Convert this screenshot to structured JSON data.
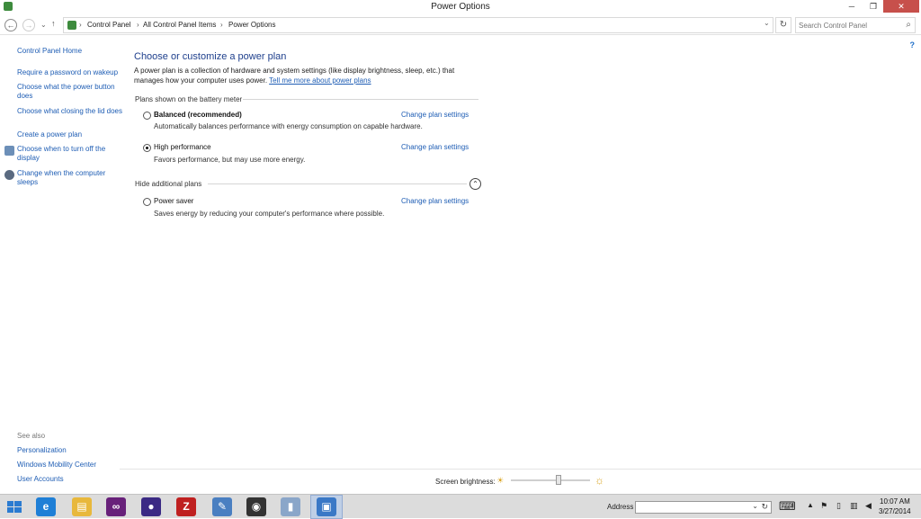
{
  "window": {
    "title": "Power Options",
    "min": "─",
    "max": "❐",
    "close": "✕"
  },
  "address_bar": {
    "back": "←",
    "forward": "→",
    "up": "↑",
    "crumbs": [
      "Control Panel",
      "All Control Panel Items",
      "Power Options"
    ],
    "separator": "›",
    "dropdown": "⌄",
    "refresh": "↻",
    "search_placeholder": "Search Control Panel",
    "search_icon": "⌕"
  },
  "help": "?",
  "sidebar": {
    "home": "Control Panel Home",
    "items": [
      {
        "label": "Require a password on wakeup"
      },
      {
        "label": "Choose what the power button does"
      },
      {
        "label": "Choose what closing the lid does"
      },
      {
        "label": "Create a power plan"
      },
      {
        "label": "Choose when to turn off the display",
        "icon": "display-icon"
      },
      {
        "label": "Change when the computer sleeps",
        "icon": "moon-icon"
      }
    ],
    "see_also": {
      "heading": "See also",
      "links": [
        "Personalization",
        "Windows Mobility Center",
        "User Accounts"
      ]
    }
  },
  "main": {
    "title": "Choose or customize a power plan",
    "description": "A power plan is a collection of hardware and system settings (like display brightness, sleep, etc.) that manages how your computer uses power.",
    "learn_more": "Tell me more about power plans",
    "battery_heading": "Plans shown on the battery meter",
    "hide_additional": "Hide additional plans",
    "collapse_glyph": "⌃",
    "change_label": "Change plan settings",
    "plans": [
      {
        "name": "Balanced (recommended)",
        "desc": "Automatically balances performance with energy consumption on capable hardware.",
        "selected": false
      },
      {
        "name": "High performance",
        "desc": "Favors performance, but may use more energy.",
        "selected": true
      },
      {
        "name": "Power saver",
        "desc": "Saves energy by reducing your computer's performance where possible.",
        "selected": false
      }
    ]
  },
  "brightness": {
    "label": "Screen brightness:",
    "level": 0.6,
    "dim_icon": "☀",
    "bright_icon": "☼"
  },
  "taskbar": {
    "start_icon": "windows-logo-icon",
    "apps": [
      {
        "name": "internet-explorer-icon",
        "glyph": "e",
        "color": "#1f7fd6"
      },
      {
        "name": "file-explorer-icon",
        "glyph": "▤",
        "color": "#e8b83c"
      },
      {
        "name": "visual-studio-icon",
        "glyph": "∞",
        "color": "#68217a"
      },
      {
        "name": "eclipse-icon",
        "glyph": "●",
        "color": "#3b2a84"
      },
      {
        "name": "filezilla-icon",
        "glyph": "Z",
        "color": "#bf2020"
      },
      {
        "name": "notepad-icon",
        "glyph": "✎",
        "color": "#4a7fc1"
      },
      {
        "name": "camera-app-icon",
        "glyph": "◉",
        "color": "#333333"
      },
      {
        "name": "document-app-icon",
        "glyph": "▮",
        "color": "#8aa6c9"
      },
      {
        "name": "control-panel-taskbar-icon",
        "glyph": "▣",
        "color": "#3a78c6"
      }
    ],
    "address_label": "Address",
    "address_dropdown": "⌄",
    "address_refresh": "↻",
    "tray_keyboard": "⌨",
    "tray_up": "▲",
    "tray_flag": "⚑",
    "tray_battery": "▯",
    "tray_network": "▥",
    "tray_volume": "◀",
    "time": "10:07 AM",
    "date": "3/27/2014"
  }
}
